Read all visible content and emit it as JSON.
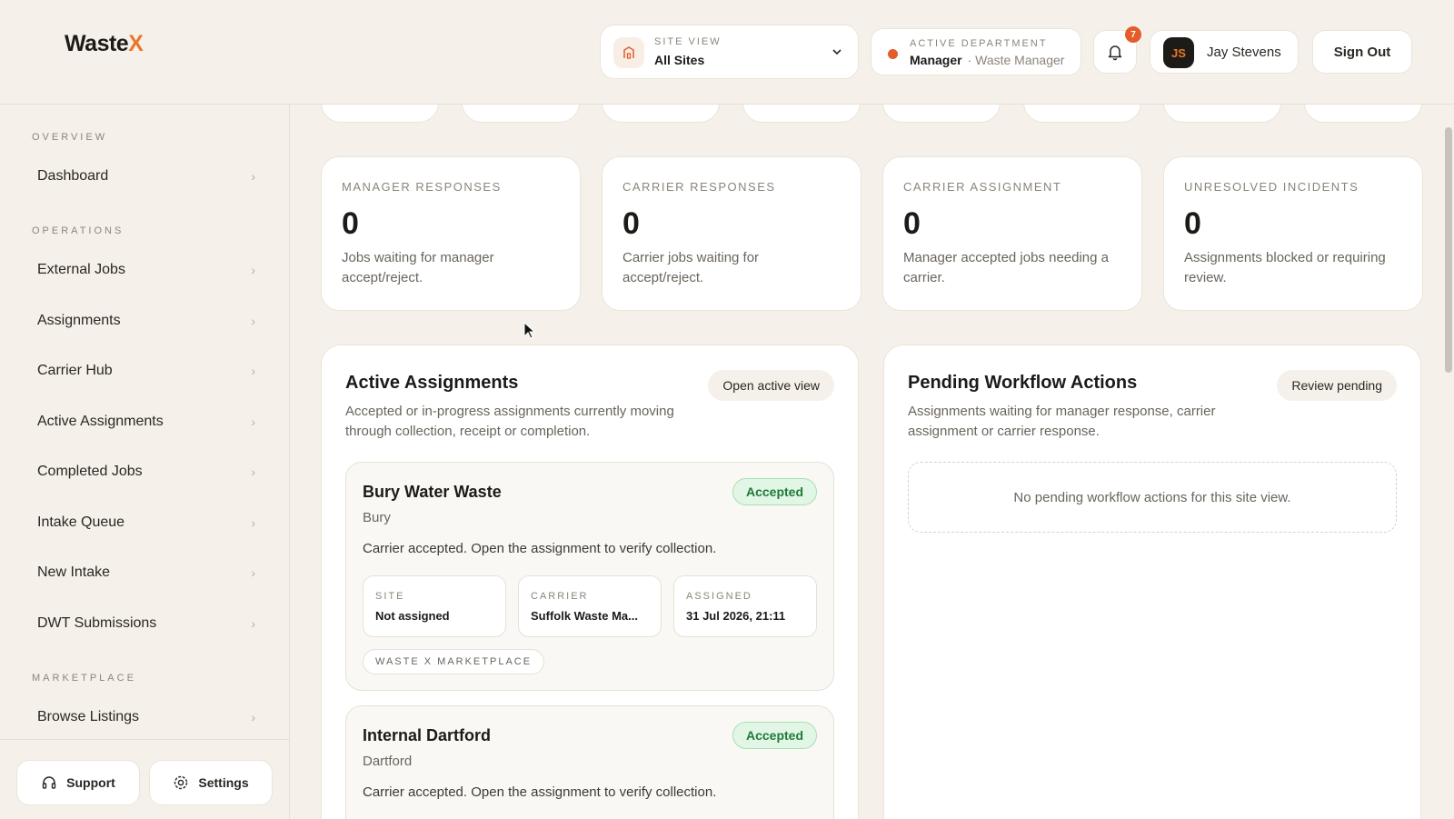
{
  "brand": {
    "name_main": "Waste",
    "name_accent": "X"
  },
  "header": {
    "site_view": {
      "label": "SITE VIEW",
      "value": "All Sites"
    },
    "department": {
      "label": "ACTIVE DEPARTMENT",
      "role": "Manager",
      "sub": "· Waste Manager"
    },
    "notifications": {
      "count": "7"
    },
    "user": {
      "initials": "JS",
      "name": "Jay Stevens"
    },
    "sign_out": "Sign Out"
  },
  "sidebar": {
    "sections": [
      "OVERVIEW",
      "OPERATIONS",
      "MARKETPLACE"
    ],
    "overview": [
      {
        "label": "Dashboard"
      }
    ],
    "operations": [
      {
        "label": "External Jobs"
      },
      {
        "label": "Assignments"
      },
      {
        "label": "Carrier Hub"
      },
      {
        "label": "Active Assignments"
      },
      {
        "label": "Completed Jobs"
      },
      {
        "label": "Intake Queue"
      },
      {
        "label": "New Intake"
      },
      {
        "label": "DWT Submissions"
      }
    ],
    "marketplace": [
      {
        "label": "Browse Listings"
      }
    ],
    "support": "Support",
    "settings": "Settings"
  },
  "stats": [
    {
      "title": "MANAGER RESPONSES",
      "value": "0",
      "desc": "Jobs waiting for manager accept/reject."
    },
    {
      "title": "CARRIER RESPONSES",
      "value": "0",
      "desc": "Carrier jobs waiting for accept/reject."
    },
    {
      "title": "CARRIER ASSIGNMENT",
      "value": "0",
      "desc": "Manager accepted jobs needing a carrier."
    },
    {
      "title": "UNRESOLVED INCIDENTS",
      "value": "0",
      "desc": "Assignments blocked or requiring review."
    }
  ],
  "active": {
    "title": "Active Assignments",
    "desc": "Accepted or in-progress assignments currently moving through collection, receipt or completion.",
    "button": "Open active view",
    "jobs": [
      {
        "title": "Bury Water Waste",
        "location": "Bury",
        "status": "Accepted",
        "note": "Carrier accepted. Open the assignment to verify collection.",
        "site_label": "SITE",
        "site": "Not assigned",
        "carrier_label": "CARRIER",
        "carrier": "Suffolk Waste Ma...",
        "assigned_label": "ASSIGNED",
        "assigned": "31 Jul 2026, 21:11",
        "tag": "WASTE X MARKETPLACE"
      },
      {
        "title": "Internal Dartford",
        "location": "Dartford",
        "status": "Accepted",
        "note": "Carrier accepted. Open the assignment to verify collection."
      }
    ]
  },
  "pending": {
    "title": "Pending Workflow Actions",
    "desc": "Assignments waiting for manager response, carrier assignment or carrier response.",
    "button": "Review pending",
    "empty": "No pending workflow actions for this site view."
  }
}
